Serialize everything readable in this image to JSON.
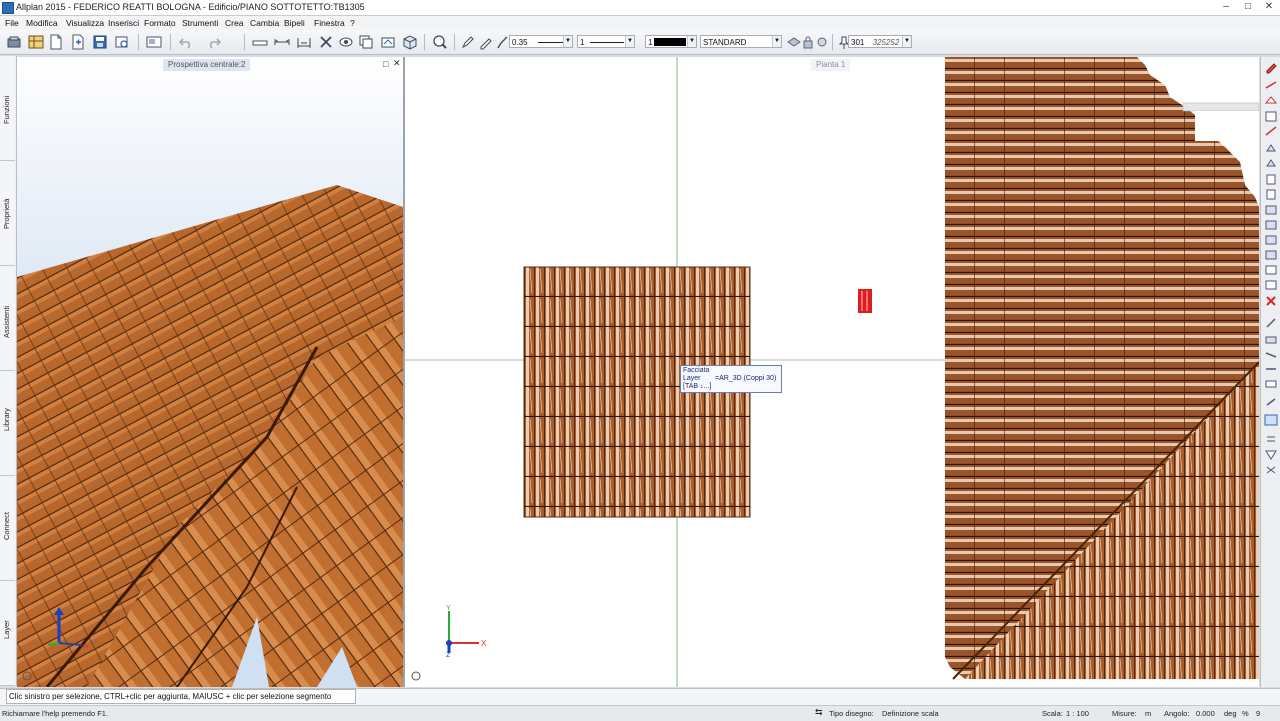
{
  "window": {
    "title": "Allplan 2015 - FEDERICO REATTI BOLOGNA - Edificio/PIANO SOTTOTETTO:TB1305",
    "minimize": "–",
    "maximize": "□",
    "close": "✕"
  },
  "menu": [
    "File",
    "Modifica",
    "Visualizza",
    "Inserisci",
    "Formato",
    "Strumenti",
    "Crea",
    "Cambia",
    "Bipeli",
    "Finestra",
    "?"
  ],
  "toolbar": {
    "pen_value": "0.35",
    "line_value": "1",
    "color_value": "1",
    "layer_value": "STANDARD",
    "number_value": "301",
    "number_extra": "325252"
  },
  "left_tabs": [
    "Funzioni",
    "Proprietà",
    "Assistenti",
    "Library",
    "Connect",
    "Layer"
  ],
  "viewport_3d": {
    "label": "Prospettiva centrale:2"
  },
  "viewport_plan": {
    "label": "Pianta 1"
  },
  "tooltip": {
    "line1": "Facciata",
    "line2_key": "Layer",
    "line2_val": "=AR_3D (Coppi 30)",
    "line3": "[TAB ↓...]"
  },
  "axes": {
    "x": "X",
    "y": "Y",
    "z": "Z"
  },
  "prompt": "Clic sinistro per selezione, CTRL+clic per aggiunta, MAIUSC + clic per selezione segmento",
  "status": {
    "help": "Richiamare l'help premendo F1.",
    "drawing_type_label": "Tipo disegno:",
    "drawing_type_value": "Definizione scala",
    "scale_label": "Scala:",
    "scale_value": "1 : 100",
    "units_label": "Misure:",
    "units_value": "m",
    "angle_label": "Angolo:",
    "angle_value": "0.000",
    "angle_unit": "deg",
    "percent": "%",
    "pages": "9"
  },
  "colors": {
    "tile": "#b8672d",
    "tile_dark": "#6a3413",
    "tile_plan": "#8a4f2a",
    "sky_bottom": "#a9c4e4",
    "red_object": "#e31b1b",
    "axis_x": "#e03030",
    "axis_y": "#2eaa2e",
    "axis_z": "#1a3fc0"
  }
}
